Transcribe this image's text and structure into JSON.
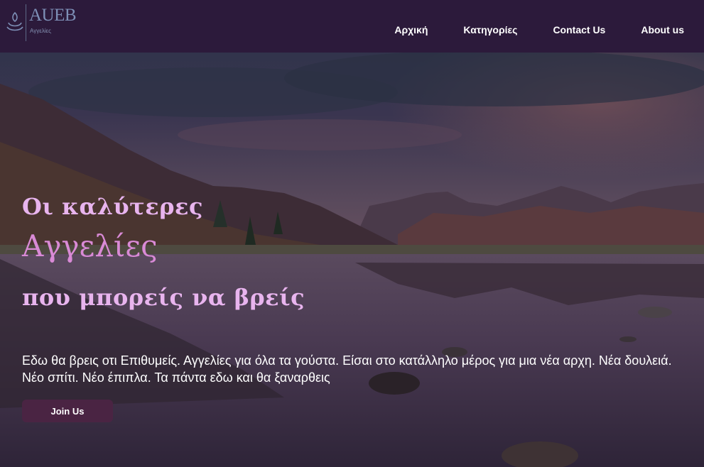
{
  "brand": {
    "name": "AUEB",
    "subtitle": "Αγγελίες",
    "icon": "lotus-logo-icon"
  },
  "nav": {
    "items": [
      {
        "label": "Αρχική"
      },
      {
        "label": "Κατηγορίες"
      },
      {
        "label": "Contact Us"
      },
      {
        "label": "About us"
      }
    ]
  },
  "hero": {
    "line1": "Οι καλύτερες",
    "line2": "Αγγελίες",
    "line3": "που μπορείς να βρείς",
    "description": "Εδω θα βρεις οτι Επιθυμείς. Αγγελίες για όλα τα γούστα. Είσαι στο κατάλληλο μέρος για μια νέα αρχη. Νέα δουλειά. Νέο σπίτι. Νέο έπιπλα. Τα πάντα εδω και θα ξαναρθεις",
    "cta_label": "Join Us",
    "background": "mountain-lake-sunset-image"
  },
  "colors": {
    "header_bg": "#2c1a3b",
    "heading": "#e8b4ee",
    "heading_accent": "#d98ad6",
    "button_bg": "#4a2443"
  }
}
